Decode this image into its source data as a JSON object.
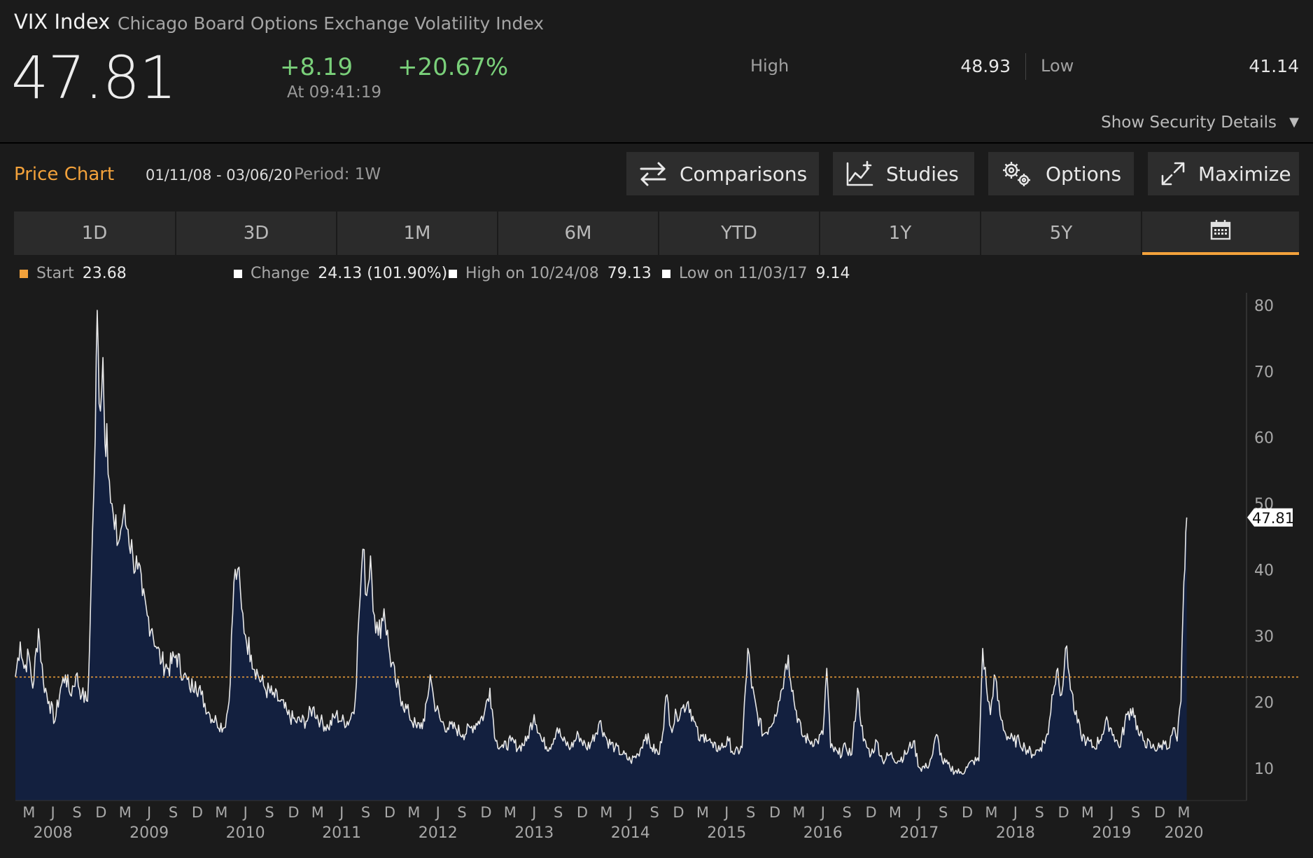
{
  "header": {
    "ticker": "VIX Index",
    "name": "Chicago Board Options Exchange Volatility Index",
    "price": "47.81",
    "change": "+8.19",
    "change_pct": "+20.67%",
    "time": "At 09:41:19",
    "high_label": "High",
    "high_value": "48.93",
    "low_label": "Low",
    "low_value": "41.14",
    "details_label": "Show Security Details",
    "details_caret": "▼"
  },
  "toolbar": {
    "title": "Price Chart",
    "date_range": "01/11/08 - 03/06/20",
    "period": "Period: 1W",
    "buttons": [
      {
        "label": "Comparisons",
        "icon": "comparisons-icon"
      },
      {
        "label": "Studies",
        "icon": "studies-icon"
      },
      {
        "label": "Options",
        "icon": "gears-icon"
      },
      {
        "label": "Maximize",
        "icon": "maximize-icon"
      }
    ]
  },
  "ranges": [
    "1D",
    "3D",
    "1M",
    "6M",
    "YTD",
    "1Y",
    "5Y",
    "calendar-icon"
  ],
  "active_range": 7,
  "colors": {
    "accent": "#f3a23b",
    "area_fill": "#13203f",
    "line": "#e8e8e8",
    "positive": "#7ad07a",
    "background": "#1b1b1b"
  },
  "legend": {
    "start_label": "Start",
    "start_value": "23.68",
    "change_label": "Change",
    "change_value": "24.13 (101.90%)",
    "high_label": "High on 10/24/08",
    "high_value": "79.13",
    "low_label": "Low on 11/03/17",
    "low_value": "9.14"
  },
  "chart_data": {
    "type": "area",
    "y_ticks": [
      10,
      20,
      30,
      40,
      50,
      60,
      70,
      80
    ],
    "ylim": [
      5,
      82
    ],
    "reference_line": 23.68,
    "current_value": "47.81",
    "month_ticks": [
      "M",
      "J",
      "S",
      "D",
      "M",
      "J",
      "S",
      "D",
      "M",
      "J",
      "S",
      "D",
      "M",
      "J",
      "S",
      "D",
      "M",
      "J",
      "S",
      "D",
      "M",
      "J",
      "S",
      "D",
      "M",
      "J",
      "S",
      "D",
      "M",
      "J",
      "S",
      "D",
      "M",
      "J",
      "S",
      "D",
      "M",
      "J",
      "S",
      "D",
      "M",
      "J",
      "S",
      "D",
      "M",
      "J",
      "S",
      "D",
      "M"
    ],
    "year_labels": [
      "2008",
      "2009",
      "2010",
      "2011",
      "2012",
      "2013",
      "2014",
      "2015",
      "2016",
      "2017",
      "2018",
      "2019",
      "2020"
    ],
    "series": [
      {
        "points": [
          [
            2008.03,
            23.7
          ],
          [
            2008.08,
            29
          ],
          [
            2008.12,
            25
          ],
          [
            2008.17,
            27
          ],
          [
            2008.21,
            22
          ],
          [
            2008.27,
            31
          ],
          [
            2008.32,
            23
          ],
          [
            2008.38,
            20
          ],
          [
            2008.44,
            17
          ],
          [
            2008.5,
            22
          ],
          [
            2008.55,
            24
          ],
          [
            2008.6,
            21
          ],
          [
            2008.66,
            24
          ],
          [
            2008.72,
            21
          ],
          [
            2008.78,
            20
          ],
          [
            2008.8,
            28
          ],
          [
            2008.83,
            45
          ],
          [
            2008.86,
            60
          ],
          [
            2008.88,
            79.13
          ],
          [
            2008.9,
            65
          ],
          [
            2008.94,
            72
          ],
          [
            2008.96,
            59
          ],
          [
            2008.98,
            62
          ],
          [
            2009.02,
            50
          ],
          [
            2009.06,
            46
          ],
          [
            2009.1,
            44
          ],
          [
            2009.15,
            48
          ],
          [
            2009.2,
            46
          ],
          [
            2009.25,
            42
          ],
          [
            2009.3,
            40
          ],
          [
            2009.35,
            36
          ],
          [
            2009.4,
            33
          ],
          [
            2009.45,
            31
          ],
          [
            2009.5,
            28
          ],
          [
            2009.55,
            26
          ],
          [
            2009.62,
            25
          ],
          [
            2009.7,
            27
          ],
          [
            2009.78,
            24
          ],
          [
            2009.84,
            22
          ],
          [
            2009.9,
            23
          ],
          [
            2009.96,
            21
          ],
          [
            2010.05,
            18
          ],
          [
            2010.12,
            17
          ],
          [
            2010.2,
            16
          ],
          [
            2010.25,
            20
          ],
          [
            2010.3,
            38
          ],
          [
            2010.34,
            40
          ],
          [
            2010.38,
            34
          ],
          [
            2010.42,
            30
          ],
          [
            2010.48,
            27
          ],
          [
            2010.55,
            24
          ],
          [
            2010.62,
            22
          ],
          [
            2010.7,
            21
          ],
          [
            2010.78,
            20
          ],
          [
            2010.86,
            18
          ],
          [
            2010.94,
            17
          ],
          [
            2011.05,
            17
          ],
          [
            2011.12,
            19
          ],
          [
            2011.2,
            17
          ],
          [
            2011.28,
            16
          ],
          [
            2011.36,
            18
          ],
          [
            2011.42,
            17
          ],
          [
            2011.5,
            17
          ],
          [
            2011.56,
            20
          ],
          [
            2011.6,
            33
          ],
          [
            2011.64,
            43
          ],
          [
            2011.68,
            36
          ],
          [
            2011.72,
            42
          ],
          [
            2011.76,
            33
          ],
          [
            2011.8,
            30
          ],
          [
            2011.86,
            34
          ],
          [
            2011.92,
            27
          ],
          [
            2011.98,
            23
          ],
          [
            2012.05,
            20
          ],
          [
            2012.12,
            18
          ],
          [
            2012.2,
            16
          ],
          [
            2012.28,
            17
          ],
          [
            2012.34,
            24
          ],
          [
            2012.38,
            20
          ],
          [
            2012.45,
            17
          ],
          [
            2012.52,
            16
          ],
          [
            2012.6,
            16
          ],
          [
            2012.68,
            15
          ],
          [
            2012.76,
            16
          ],
          [
            2012.84,
            17
          ],
          [
            2012.9,
            18
          ],
          [
            2012.96,
            22
          ],
          [
            2013.02,
            14
          ],
          [
            2013.1,
            13
          ],
          [
            2013.18,
            14
          ],
          [
            2013.26,
            13
          ],
          [
            2013.34,
            14
          ],
          [
            2013.42,
            18
          ],
          [
            2013.5,
            14
          ],
          [
            2013.58,
            13
          ],
          [
            2013.66,
            16
          ],
          [
            2013.72,
            14
          ],
          [
            2013.8,
            13
          ],
          [
            2013.88,
            15
          ],
          [
            2013.96,
            13
          ],
          [
            2014.02,
            14
          ],
          [
            2014.1,
            17
          ],
          [
            2014.18,
            14
          ],
          [
            2014.26,
            13
          ],
          [
            2014.34,
            12
          ],
          [
            2014.42,
            11
          ],
          [
            2014.5,
            12
          ],
          [
            2014.58,
            15
          ],
          [
            2014.64,
            13
          ],
          [
            2014.72,
            12
          ],
          [
            2014.8,
            21
          ],
          [
            2014.84,
            16
          ],
          [
            2014.9,
            18
          ],
          [
            2014.96,
            19
          ],
          [
            2015.02,
            20
          ],
          [
            2015.08,
            17
          ],
          [
            2015.14,
            14
          ],
          [
            2015.2,
            15
          ],
          [
            2015.28,
            13
          ],
          [
            2015.36,
            13
          ],
          [
            2015.44,
            14
          ],
          [
            2015.5,
            12
          ],
          [
            2015.58,
            13
          ],
          [
            2015.64,
            28
          ],
          [
            2015.68,
            22
          ],
          [
            2015.74,
            18
          ],
          [
            2015.8,
            15
          ],
          [
            2015.86,
            16
          ],
          [
            2015.92,
            18
          ],
          [
            2015.96,
            20
          ],
          [
            2016.02,
            24
          ],
          [
            2016.06,
            27
          ],
          [
            2016.12,
            20
          ],
          [
            2016.2,
            15
          ],
          [
            2016.28,
            14
          ],
          [
            2016.36,
            14
          ],
          [
            2016.42,
            15
          ],
          [
            2016.46,
            25
          ],
          [
            2016.5,
            13
          ],
          [
            2016.58,
            12
          ],
          [
            2016.66,
            13
          ],
          [
            2016.72,
            12
          ],
          [
            2016.78,
            22
          ],
          [
            2016.84,
            14
          ],
          [
            2016.92,
            12
          ],
          [
            2016.98,
            14
          ],
          [
            2017.04,
            11
          ],
          [
            2017.12,
            12
          ],
          [
            2017.2,
            11
          ],
          [
            2017.28,
            12
          ],
          [
            2017.36,
            14
          ],
          [
            2017.42,
            10
          ],
          [
            2017.5,
            10
          ],
          [
            2017.56,
            12
          ],
          [
            2017.6,
            15
          ],
          [
            2017.66,
            11
          ],
          [
            2017.74,
            10
          ],
          [
            2017.84,
            9.14
          ],
          [
            2017.92,
            10
          ],
          [
            2017.98,
            11
          ],
          [
            2018.04,
            11
          ],
          [
            2018.08,
            28
          ],
          [
            2018.12,
            22
          ],
          [
            2018.16,
            18
          ],
          [
            2018.2,
            24
          ],
          [
            2018.26,
            18
          ],
          [
            2018.32,
            15
          ],
          [
            2018.4,
            14
          ],
          [
            2018.46,
            14
          ],
          [
            2018.52,
            13
          ],
          [
            2018.6,
            12
          ],
          [
            2018.68,
            13
          ],
          [
            2018.76,
            15
          ],
          [
            2018.8,
            21
          ],
          [
            2018.86,
            25
          ],
          [
            2018.9,
            21
          ],
          [
            2018.94,
            28
          ],
          [
            2018.98,
            24
          ],
          [
            2019.04,
            18
          ],
          [
            2019.1,
            15
          ],
          [
            2019.16,
            14
          ],
          [
            2019.24,
            13
          ],
          [
            2019.32,
            15
          ],
          [
            2019.38,
            17
          ],
          [
            2019.44,
            15
          ],
          [
            2019.5,
            13
          ],
          [
            2019.58,
            18
          ],
          [
            2019.64,
            19
          ],
          [
            2019.7,
            15
          ],
          [
            2019.76,
            14
          ],
          [
            2019.84,
            13
          ],
          [
            2019.92,
            13
          ],
          [
            2019.98,
            14
          ],
          [
            2020.02,
            13
          ],
          [
            2020.06,
            16
          ],
          [
            2020.1,
            14
          ],
          [
            2020.14,
            20
          ],
          [
            2020.16,
            33
          ],
          [
            2020.18,
            40
          ],
          [
            2020.2,
            47.81
          ]
        ]
      }
    ]
  }
}
